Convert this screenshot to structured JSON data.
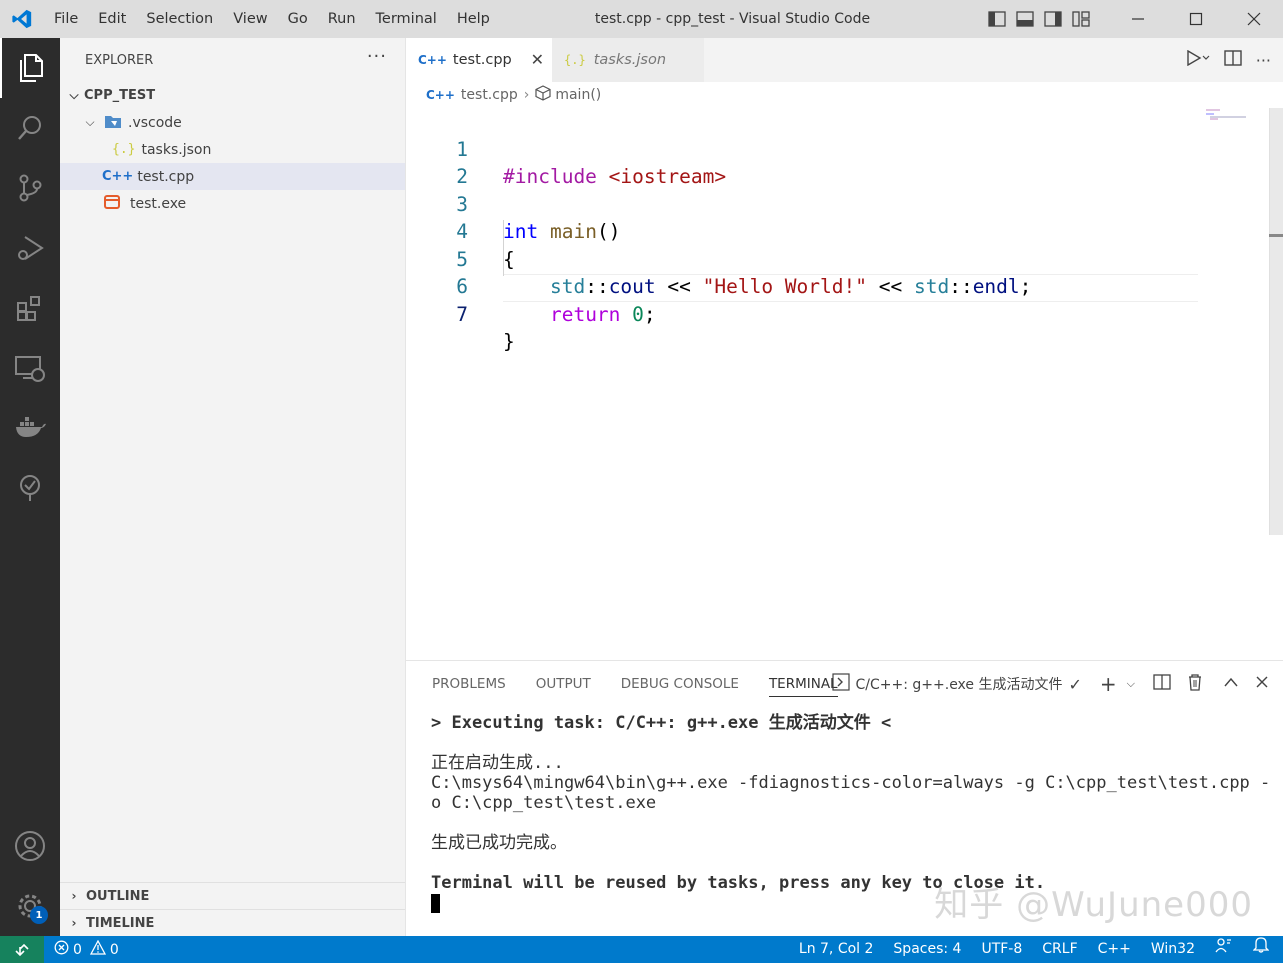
{
  "window": {
    "title": "test.cpp - cpp_test - Visual Studio Code",
    "menu": [
      "File",
      "Edit",
      "Selection",
      "View",
      "Go",
      "Run",
      "Terminal",
      "Help"
    ]
  },
  "activity": {
    "items": [
      "explorer-icon",
      "search-icon",
      "source-control-icon",
      "run-debug-icon",
      "extensions-icon",
      "remote-explorer-icon",
      "docker-icon",
      "tree-icon"
    ],
    "account_icon": "account-icon",
    "settings_badge": "1"
  },
  "sidebar": {
    "title": "EXPLORER",
    "more": "···",
    "root": "CPP_TEST",
    "tree": [
      {
        "label": ".vscode",
        "icon": "vscode-folder-icon"
      },
      {
        "label": "tasks.json",
        "icon": "json-icon"
      },
      {
        "label": "test.cpp",
        "icon": "cpp-icon"
      },
      {
        "label": "test.exe",
        "icon": "exe-icon"
      }
    ],
    "outline": "OUTLINE",
    "timeline": "TIMELINE"
  },
  "tabs": [
    {
      "label": "test.cpp",
      "close": "✕"
    },
    {
      "label": "tasks.json"
    }
  ],
  "breadcrumb": {
    "file": "test.cpp",
    "symbol": "main()"
  },
  "code": {
    "line_numbers": [
      "1",
      "2",
      "3",
      "4",
      "5",
      "6",
      "7"
    ],
    "l1_pre": "#include",
    "l1_inc": "<iostream>",
    "l3_kw": "int",
    "l3_fn": "main",
    "l3_paren": "()",
    "l4": "{",
    "l5_indent": "    ",
    "l5_ns1": "std",
    "l5_sep1": "::",
    "l5_id1": "cout",
    "l5_op1": " << ",
    "l5_str": "\"Hello World!\"",
    "l5_op2": " << ",
    "l5_ns2": "std",
    "l5_sep2": "::",
    "l5_id2": "endl",
    "l5_semi": ";",
    "l6_indent": "    ",
    "l6_kw": "return",
    "l6_num": "0",
    "l6_semi": ";",
    "l7": "}"
  },
  "panel": {
    "tabs": [
      "PROBLEMS",
      "OUTPUT",
      "DEBUG CONSOLE",
      "TERMINAL"
    ],
    "task_label": "C/C++: g++.exe 生成活动文件",
    "terminal": {
      "line1": "> Executing task: C/C++: g++.exe 生成活动文件 <",
      "line2": "正在启动生成...",
      "line3": "C:\\msys64\\mingw64\\bin\\g++.exe -fdiagnostics-color=always -g C:\\cpp_test\\test.cpp -",
      "line4": "o C:\\cpp_test\\test.exe",
      "line5": "生成已成功完成。",
      "line6": "Terminal will be reused by tasks, press any key to close it."
    },
    "watermark": "知乎 @WuJune000"
  },
  "statusbar": {
    "errors": "0",
    "warnings": "0",
    "position": "Ln 7, Col 2",
    "spaces": "Spaces: 4",
    "encoding": "UTF-8",
    "eol": "CRLF",
    "language": "C++",
    "platform": "Win32"
  },
  "colors": {
    "statusbar": "#007acc",
    "activitybar": "#2c2c2c",
    "titlebar": "#dddddd",
    "accent": "#005fb8"
  }
}
